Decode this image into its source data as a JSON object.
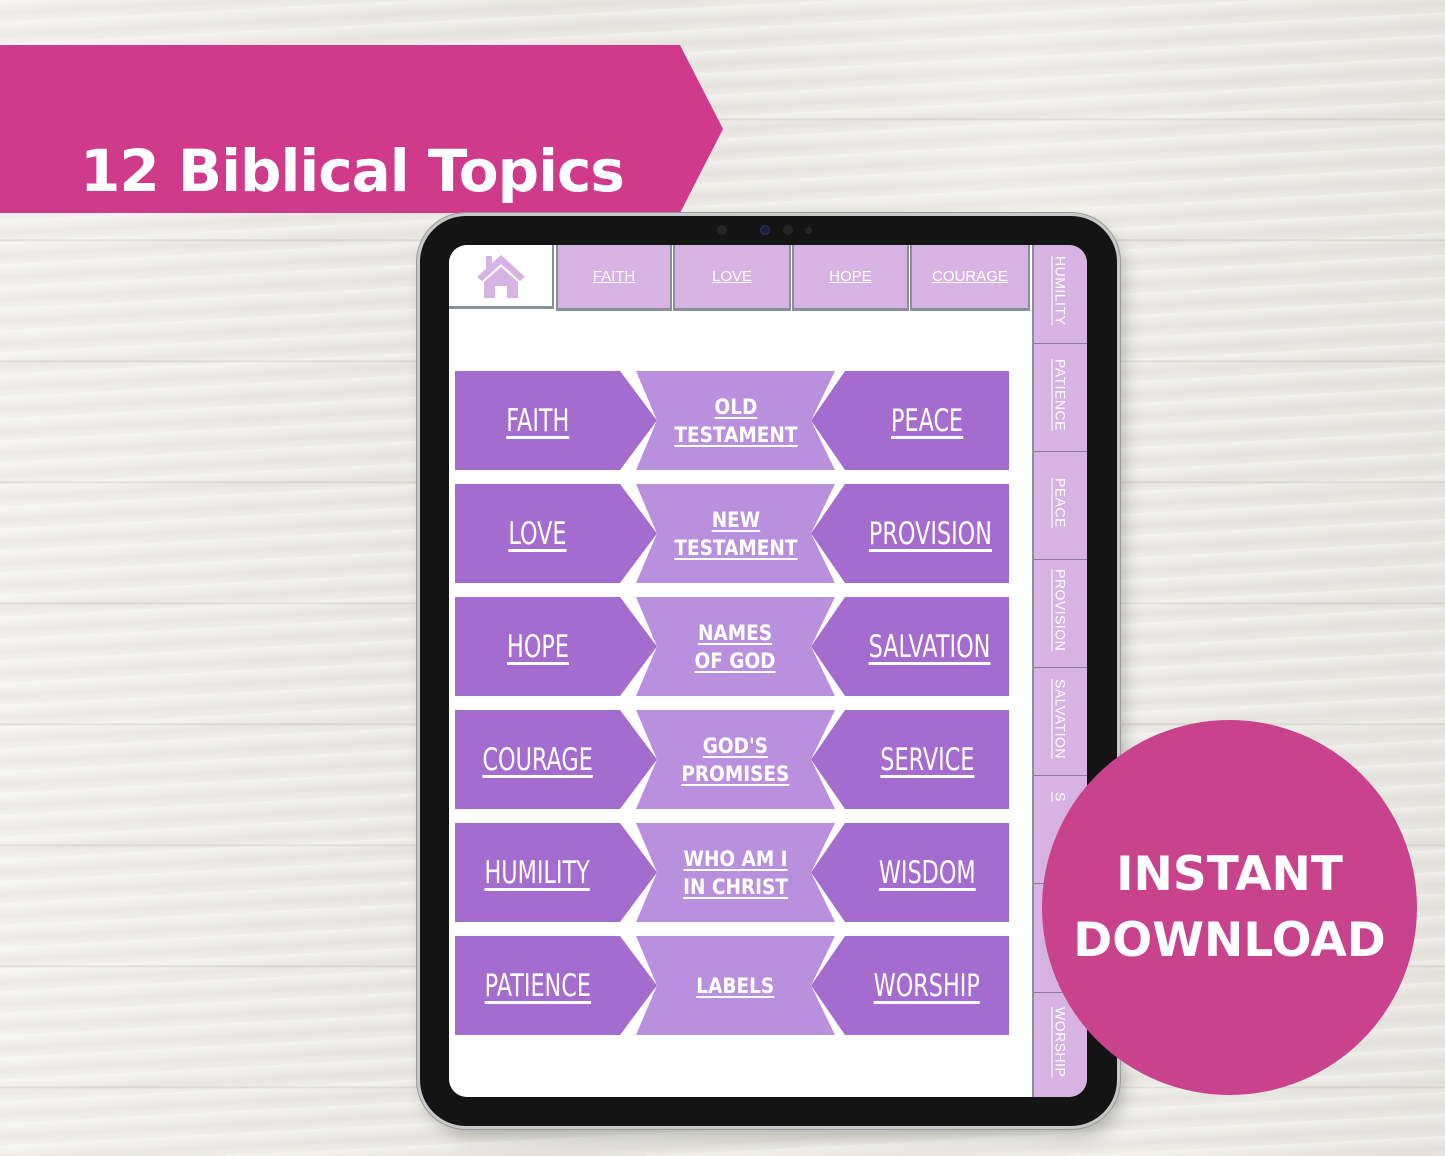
{
  "banner": {
    "title": "12 Biblical Topics",
    "color": "#cf3a8a"
  },
  "badge": {
    "line1": "INSTANT",
    "line2": "DOWNLOAD",
    "color": "#c8428c"
  },
  "planner": {
    "home_icon": "home-icon",
    "top_tabs": [
      {
        "label": "FAITH"
      },
      {
        "label": "LOVE"
      },
      {
        "label": "HOPE"
      },
      {
        "label": "COURAGE"
      }
    ],
    "side_tabs": [
      {
        "label": "HUMILITY"
      },
      {
        "label": "PATIENCE"
      },
      {
        "label": "PEACE"
      },
      {
        "label": "PROVISION"
      },
      {
        "label": "SALVATION"
      },
      {
        "label": "S"
      },
      {
        "label": ""
      },
      {
        "label": "WORSHIP"
      }
    ],
    "rows": [
      {
        "left": "FAITH",
        "center": [
          "OLD",
          "TESTAMENT"
        ],
        "right": "PEACE"
      },
      {
        "left": "LOVE",
        "center": [
          "NEW",
          "TESTAMENT"
        ],
        "right": "PROVISION"
      },
      {
        "left": "HOPE",
        "center": [
          "NAMES",
          "OF GOD"
        ],
        "right": "SALVATION"
      },
      {
        "left": "COURAGE",
        "center": [
          "GOD'S",
          "PROMISES"
        ],
        "right": "SERVICE"
      },
      {
        "left": "HUMILITY",
        "center": [
          "WHO AM I",
          "IN CHRIST"
        ],
        "right": "WISDOM"
      },
      {
        "left": "PATIENCE",
        "center": [
          "LABELS"
        ],
        "right": "WORSHIP"
      }
    ],
    "colors": {
      "tab": "#d6b3e3",
      "arrow": "#a56ccf",
      "center": "#b990dd",
      "tab_border": "#8a909a"
    }
  }
}
